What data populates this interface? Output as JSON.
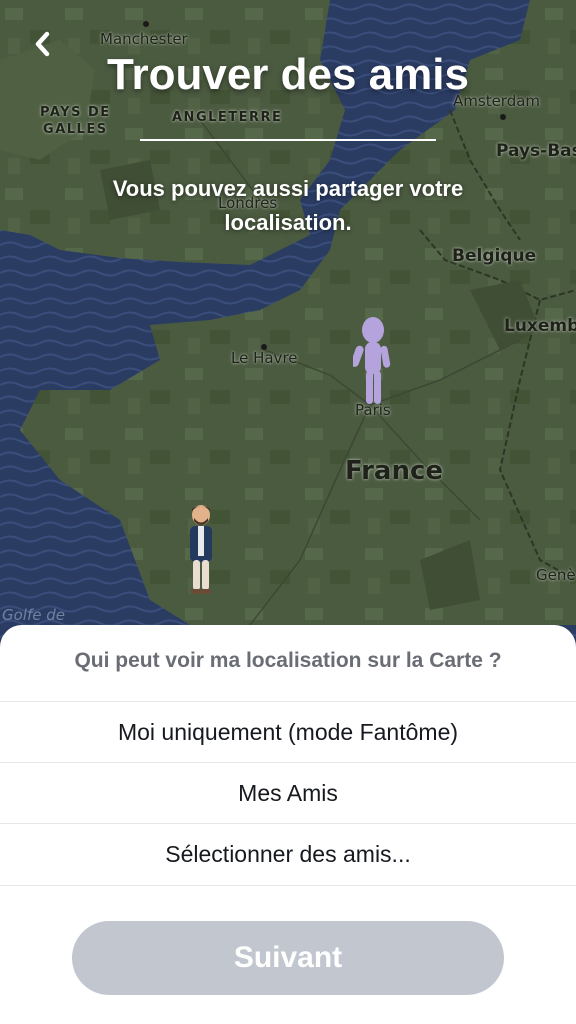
{
  "header": {
    "title": "Trouver des amis",
    "subtitle": "Vous pouvez aussi partager votre localisation."
  },
  "map": {
    "labels": {
      "manchester": "Manchester",
      "pays_de_galles": "PAYS DE\nGALLES",
      "angleterre": "ANGLETERRE",
      "amsterdam": "Amsterdam",
      "pays_bas": "Pays-Bas",
      "londres": "Londres",
      "belgique": "Belgique",
      "luxembourg": "Luxemb",
      "le_havre": "Le Havre",
      "paris": "Paris",
      "france": "France",
      "geneve": "Genè",
      "golfe": "Golfe de"
    }
  },
  "sheet": {
    "question": "Qui peut voir ma localisation sur la Carte ?",
    "options": [
      "Moi uniquement (mode Fantôme)",
      "Mes Amis",
      "Sélectionner des amis..."
    ],
    "next_label": "Suivant"
  },
  "icons": {
    "back": "chevron-left-icon",
    "ghost_avatar": "ghost-avatar-icon",
    "user_avatar": "bitmoji-avatar-icon"
  },
  "colors": {
    "sea": "#2b3c63",
    "land": "#4a5a3f",
    "button_disabled": "#c2c7cf",
    "ghost": "#b5a3dd"
  }
}
